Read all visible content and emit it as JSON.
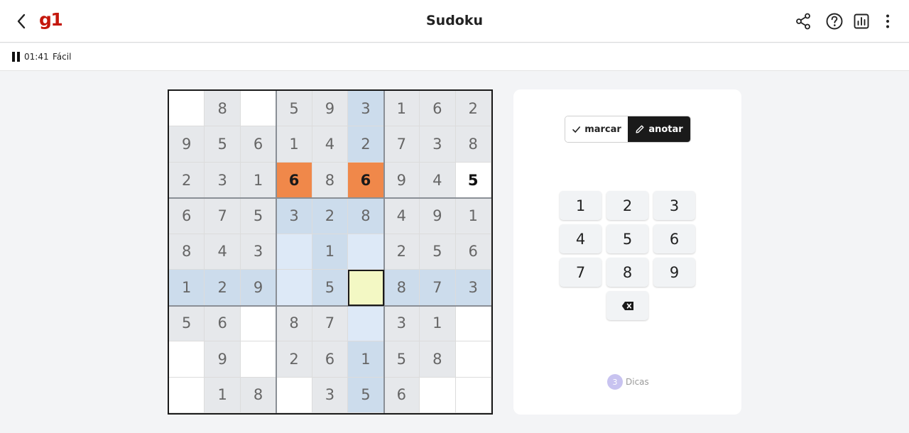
{
  "header": {
    "logo": "g1",
    "title": "Sudoku",
    "icons": [
      "back-icon",
      "share-icon",
      "help-icon",
      "stats-icon",
      "more-vertical-icon"
    ]
  },
  "status": {
    "timer": "01:41",
    "level": "Fácil"
  },
  "board": {
    "rows": [
      [
        "",
        "8",
        "",
        "5",
        "9",
        "3",
        "1",
        "6",
        "2"
      ],
      [
        "9",
        "5",
        "6",
        "1",
        "4",
        "2",
        "7",
        "3",
        "8"
      ],
      [
        "2",
        "3",
        "1",
        "6",
        "8",
        "6",
        "9",
        "4",
        "5"
      ],
      [
        "6",
        "7",
        "5",
        "3",
        "2",
        "8",
        "4",
        "9",
        "1"
      ],
      [
        "8",
        "4",
        "3",
        "",
        "1",
        "",
        "2",
        "5",
        "6"
      ],
      [
        "1",
        "2",
        "9",
        "",
        "5",
        "",
        "8",
        "7",
        "3"
      ],
      [
        "5",
        "6",
        "",
        "8",
        "7",
        "",
        "3",
        "1",
        ""
      ],
      [
        "",
        "9",
        "",
        "2",
        "6",
        "1",
        "5",
        "8",
        ""
      ],
      [
        "",
        "1",
        "8",
        "",
        "3",
        "5",
        "6",
        "",
        ""
      ]
    ],
    "selected": {
      "row": 5,
      "col": 5
    },
    "conflicts": [
      [
        2,
        3
      ],
      [
        2,
        5
      ]
    ],
    "user_entries": [
      [
        2,
        8
      ]
    ],
    "colors": {
      "given": "#e6e8eb",
      "highlight": "#ccdcec",
      "highlight_empty": "#dde9f7",
      "conflict": "#f0884a",
      "selected": "#f3f8c4"
    }
  },
  "controls": {
    "mode_marcar": "marcar",
    "mode_anotar": "anotar",
    "active_mode": "anotar",
    "keys": [
      "1",
      "2",
      "3",
      "4",
      "5",
      "6",
      "7",
      "8",
      "9"
    ],
    "erase_icon": "backspace-icon"
  },
  "hints": {
    "count": "3",
    "label": "Dicas"
  }
}
